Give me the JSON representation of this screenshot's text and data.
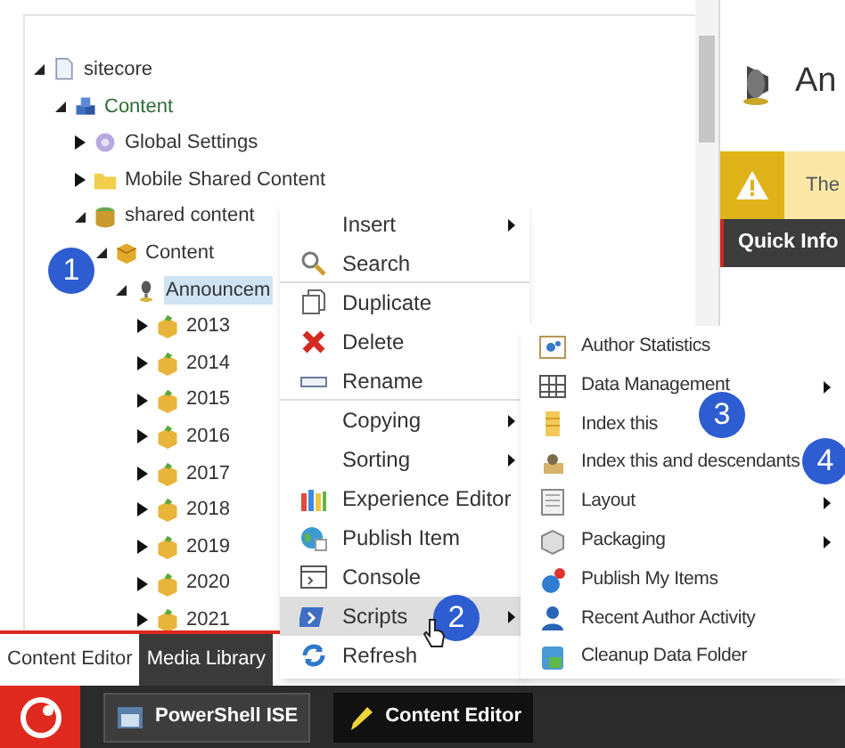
{
  "tree": [
    {
      "label": "sitecore",
      "expanded": true,
      "selected": false,
      "children": [
        {
          "label": "Content",
          "expanded": true,
          "selected": false,
          "children": [
            {
              "label": "Global Settings",
              "expanded": false,
              "selected": false
            },
            {
              "label": "Mobile Shared Content",
              "expanded": false,
              "selected": false
            },
            {
              "label": "shared content",
              "expanded": true,
              "selected": false,
              "children": [
                {
                  "label": "Content",
                  "expanded": true,
                  "selected": false,
                  "children": [
                    {
                      "label": "Announcem",
                      "expanded": true,
                      "selected": true,
                      "children": [
                        {
                          "label": "2013",
                          "expanded": false,
                          "selected": false
                        },
                        {
                          "label": "2014",
                          "expanded": false,
                          "selected": false
                        },
                        {
                          "label": "2015",
                          "expanded": false,
                          "selected": false
                        },
                        {
                          "label": "2016",
                          "expanded": false,
                          "selected": false
                        },
                        {
                          "label": "2017",
                          "expanded": false,
                          "selected": false
                        },
                        {
                          "label": "2018",
                          "expanded": false,
                          "selected": false
                        },
                        {
                          "label": "2019",
                          "expanded": false,
                          "selected": false
                        },
                        {
                          "label": "2020",
                          "expanded": false,
                          "selected": false
                        },
                        {
                          "label": "2021",
                          "expanded": false,
                          "selected": false
                        }
                      ]
                    }
                  ]
                }
              ]
            }
          ]
        }
      ]
    }
  ],
  "right_pane": {
    "title": "An",
    "warning": "The",
    "quick_info": "Quick Info"
  },
  "context_menu": [
    {
      "label": "Insert",
      "submenu": true,
      "selected": false,
      "separator_after": false
    },
    {
      "label": "Search",
      "submenu": false,
      "selected": false,
      "separator_after": true
    },
    {
      "label": "Duplicate",
      "submenu": false,
      "selected": false,
      "separator_after": false
    },
    {
      "label": "Delete",
      "submenu": false,
      "selected": false,
      "separator_after": false
    },
    {
      "label": "Rename",
      "submenu": false,
      "selected": false,
      "separator_after": true
    },
    {
      "label": "Copying",
      "submenu": true,
      "selected": false,
      "separator_after": false
    },
    {
      "label": "Sorting",
      "submenu": true,
      "selected": false,
      "separator_after": false
    },
    {
      "label": "Experience Editor",
      "submenu": false,
      "selected": false,
      "separator_after": false
    },
    {
      "label": "Publish Item",
      "submenu": false,
      "selected": false,
      "separator_after": false
    },
    {
      "label": "Console",
      "submenu": false,
      "selected": false,
      "separator_after": false
    },
    {
      "label": "Scripts",
      "submenu": true,
      "selected": true,
      "separator_after": false
    },
    {
      "label": "Refresh",
      "submenu": false,
      "selected": false,
      "separator_after": false
    }
  ],
  "scripts_submenu": [
    {
      "label": "Author Statistics",
      "submenu": false
    },
    {
      "label": "Data Management",
      "submenu": true
    },
    {
      "label": "Index this",
      "submenu": false
    },
    {
      "label": "Index this and descendants",
      "submenu": false
    },
    {
      "label": "Layout",
      "submenu": true
    },
    {
      "label": "Packaging",
      "submenu": true
    },
    {
      "label": "Publish My Items",
      "submenu": false
    },
    {
      "label": "Recent Author Activity",
      "submenu": false
    },
    {
      "label": "Cleanup Data Folder",
      "submenu": false
    }
  ],
  "callouts": [
    "1",
    "2",
    "3",
    "4"
  ],
  "bottom_tabs": [
    {
      "label": "Content Editor",
      "selected": true
    },
    {
      "label": "Media Library",
      "selected": false
    }
  ],
  "taskbar": [
    {
      "label": "PowerShell ISE",
      "selected": false
    },
    {
      "label": "Content Editor",
      "selected": true
    }
  ]
}
